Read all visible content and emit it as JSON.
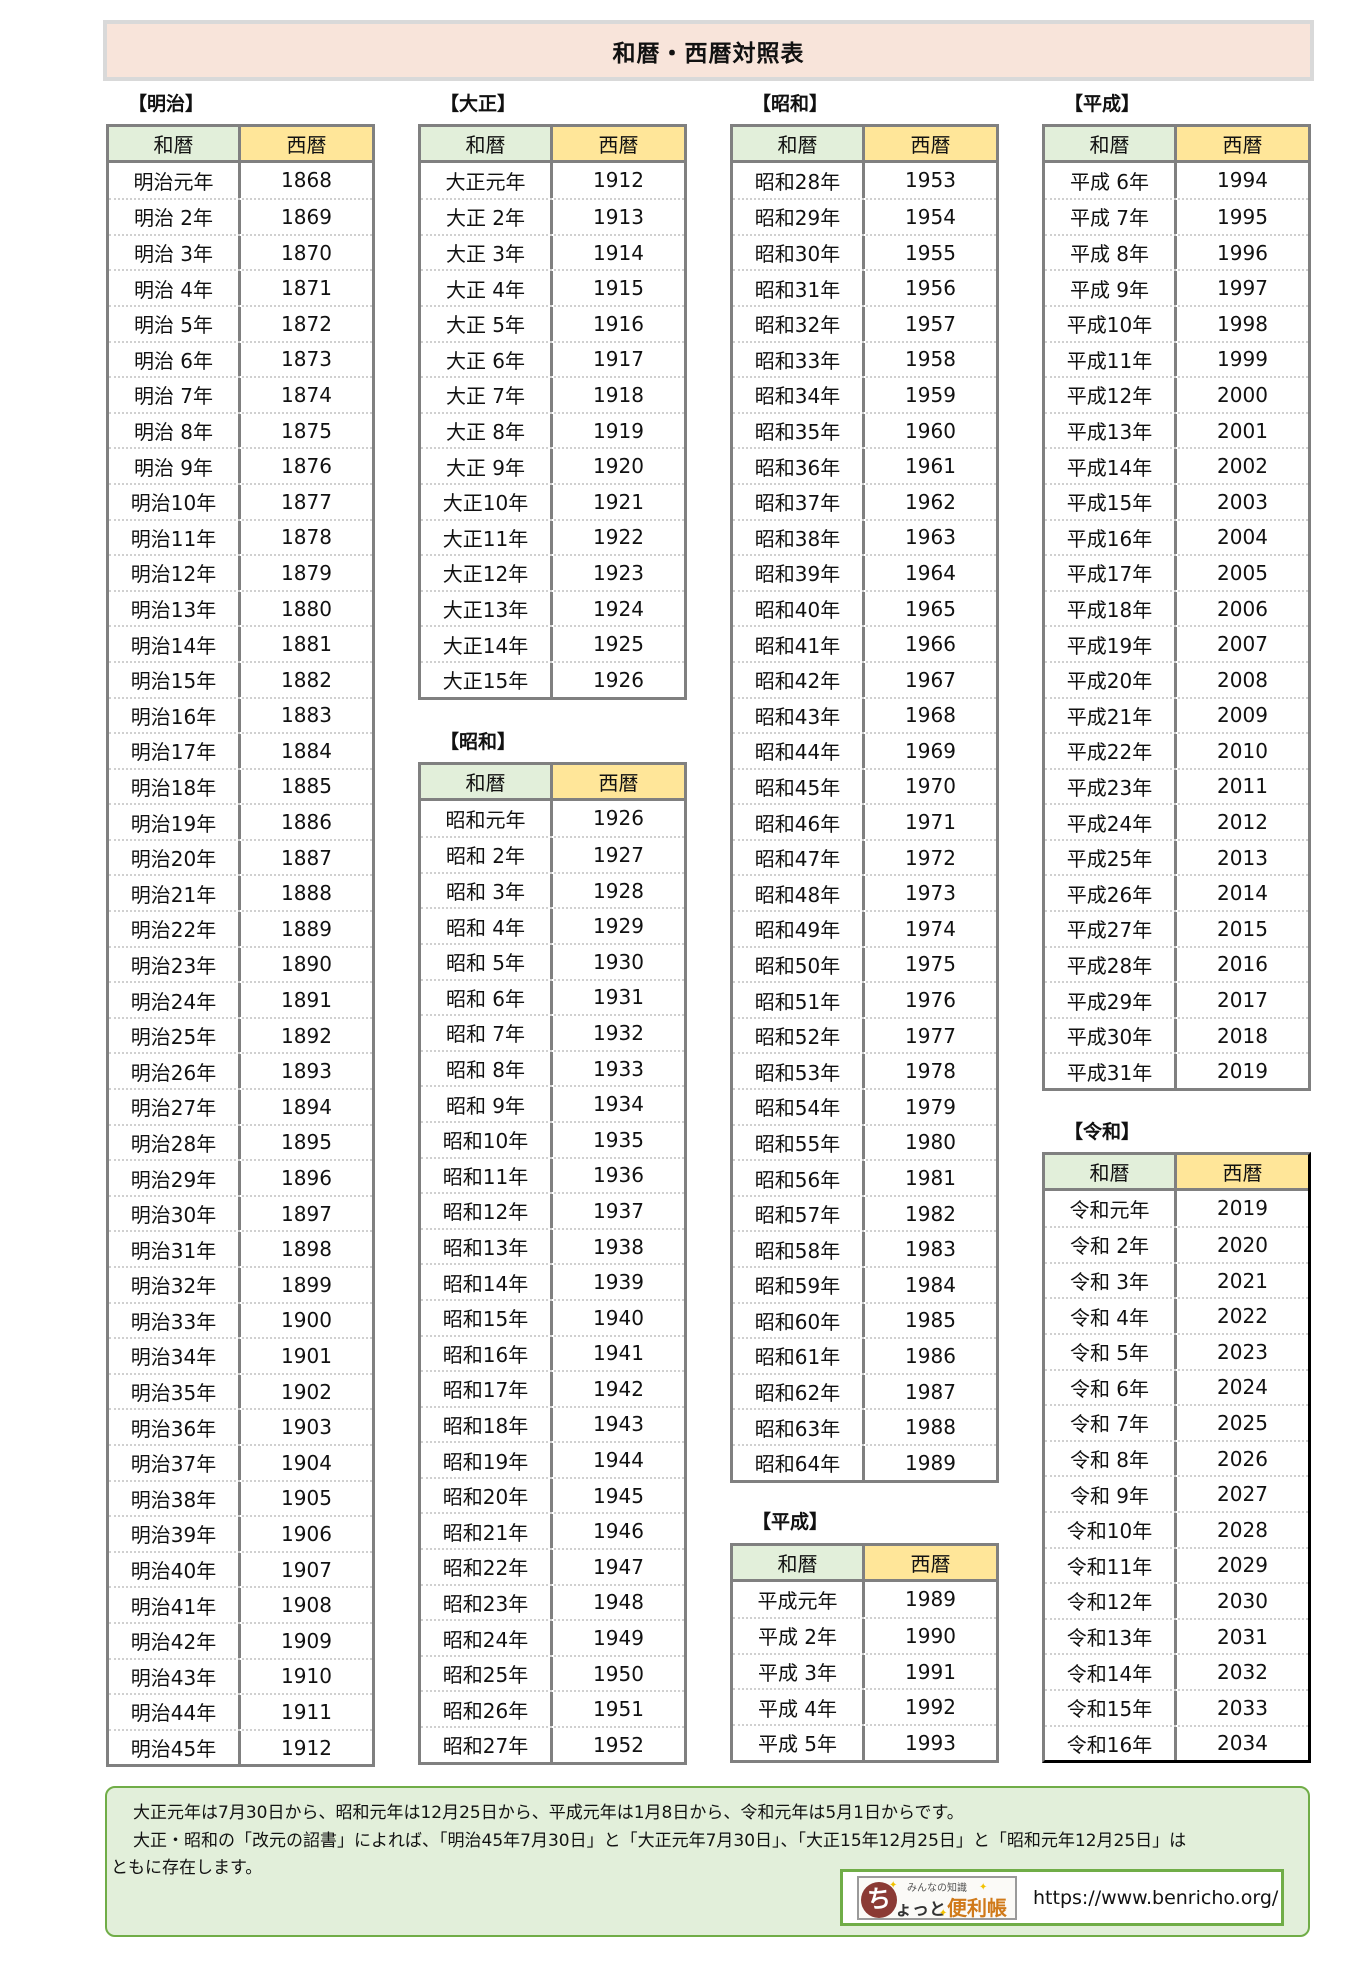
{
  "title": "和暦・西暦対照表",
  "header": {
    "wareki": "和暦",
    "seireki": "西暦"
  },
  "colors": {
    "title_fill": "#f8e4da",
    "wareki_header": "#e2efda",
    "seireki_header": "#ffe699",
    "border": "#808080",
    "footer_fill": "#e2efda",
    "footer_border": "#70ad47"
  },
  "tables": [
    {
      "label": "【明治】",
      "rows": [
        [
          "明治元年",
          "1868"
        ],
        [
          "明治 2年",
          "1869"
        ],
        [
          "明治 3年",
          "1870"
        ],
        [
          "明治 4年",
          "1871"
        ],
        [
          "明治 5年",
          "1872"
        ],
        [
          "明治 6年",
          "1873"
        ],
        [
          "明治 7年",
          "1874"
        ],
        [
          "明治 8年",
          "1875"
        ],
        [
          "明治 9年",
          "1876"
        ],
        [
          "明治10年",
          "1877"
        ],
        [
          "明治11年",
          "1878"
        ],
        [
          "明治12年",
          "1879"
        ],
        [
          "明治13年",
          "1880"
        ],
        [
          "明治14年",
          "1881"
        ],
        [
          "明治15年",
          "1882"
        ],
        [
          "明治16年",
          "1883"
        ],
        [
          "明治17年",
          "1884"
        ],
        [
          "明治18年",
          "1885"
        ],
        [
          "明治19年",
          "1886"
        ],
        [
          "明治20年",
          "1887"
        ],
        [
          "明治21年",
          "1888"
        ],
        [
          "明治22年",
          "1889"
        ],
        [
          "明治23年",
          "1890"
        ],
        [
          "明治24年",
          "1891"
        ],
        [
          "明治25年",
          "1892"
        ],
        [
          "明治26年",
          "1893"
        ],
        [
          "明治27年",
          "1894"
        ],
        [
          "明治28年",
          "1895"
        ],
        [
          "明治29年",
          "1896"
        ],
        [
          "明治30年",
          "1897"
        ],
        [
          "明治31年",
          "1898"
        ],
        [
          "明治32年",
          "1899"
        ],
        [
          "明治33年",
          "1900"
        ],
        [
          "明治34年",
          "1901"
        ],
        [
          "明治35年",
          "1902"
        ],
        [
          "明治36年",
          "1903"
        ],
        [
          "明治37年",
          "1904"
        ],
        [
          "明治38年",
          "1905"
        ],
        [
          "明治39年",
          "1906"
        ],
        [
          "明治40年",
          "1907"
        ],
        [
          "明治41年",
          "1908"
        ],
        [
          "明治42年",
          "1909"
        ],
        [
          "明治43年",
          "1910"
        ],
        [
          "明治44年",
          "1911"
        ],
        [
          "明治45年",
          "1912"
        ]
      ]
    },
    {
      "label": "【大正】",
      "rows": [
        [
          "大正元年",
          "1912"
        ],
        [
          "大正 2年",
          "1913"
        ],
        [
          "大正 3年",
          "1914"
        ],
        [
          "大正 4年",
          "1915"
        ],
        [
          "大正 5年",
          "1916"
        ],
        [
          "大正 6年",
          "1917"
        ],
        [
          "大正 7年",
          "1918"
        ],
        [
          "大正 8年",
          "1919"
        ],
        [
          "大正 9年",
          "1920"
        ],
        [
          "大正10年",
          "1921"
        ],
        [
          "大正11年",
          "1922"
        ],
        [
          "大正12年",
          "1923"
        ],
        [
          "大正13年",
          "1924"
        ],
        [
          "大正14年",
          "1925"
        ],
        [
          "大正15年",
          "1926"
        ]
      ]
    },
    {
      "label": "【昭和】",
      "rows": [
        [
          "昭和元年",
          "1926"
        ],
        [
          "昭和 2年",
          "1927"
        ],
        [
          "昭和 3年",
          "1928"
        ],
        [
          "昭和 4年",
          "1929"
        ],
        [
          "昭和 5年",
          "1930"
        ],
        [
          "昭和 6年",
          "1931"
        ],
        [
          "昭和 7年",
          "1932"
        ],
        [
          "昭和 8年",
          "1933"
        ],
        [
          "昭和 9年",
          "1934"
        ],
        [
          "昭和10年",
          "1935"
        ],
        [
          "昭和11年",
          "1936"
        ],
        [
          "昭和12年",
          "1937"
        ],
        [
          "昭和13年",
          "1938"
        ],
        [
          "昭和14年",
          "1939"
        ],
        [
          "昭和15年",
          "1940"
        ],
        [
          "昭和16年",
          "1941"
        ],
        [
          "昭和17年",
          "1942"
        ],
        [
          "昭和18年",
          "1943"
        ],
        [
          "昭和19年",
          "1944"
        ],
        [
          "昭和20年",
          "1945"
        ],
        [
          "昭和21年",
          "1946"
        ],
        [
          "昭和22年",
          "1947"
        ],
        [
          "昭和23年",
          "1948"
        ],
        [
          "昭和24年",
          "1949"
        ],
        [
          "昭和25年",
          "1950"
        ],
        [
          "昭和26年",
          "1951"
        ],
        [
          "昭和27年",
          "1952"
        ]
      ]
    },
    {
      "label": "【昭和】",
      "rows": [
        [
          "昭和28年",
          "1953"
        ],
        [
          "昭和29年",
          "1954"
        ],
        [
          "昭和30年",
          "1955"
        ],
        [
          "昭和31年",
          "1956"
        ],
        [
          "昭和32年",
          "1957"
        ],
        [
          "昭和33年",
          "1958"
        ],
        [
          "昭和34年",
          "1959"
        ],
        [
          "昭和35年",
          "1960"
        ],
        [
          "昭和36年",
          "1961"
        ],
        [
          "昭和37年",
          "1962"
        ],
        [
          "昭和38年",
          "1963"
        ],
        [
          "昭和39年",
          "1964"
        ],
        [
          "昭和40年",
          "1965"
        ],
        [
          "昭和41年",
          "1966"
        ],
        [
          "昭和42年",
          "1967"
        ],
        [
          "昭和43年",
          "1968"
        ],
        [
          "昭和44年",
          "1969"
        ],
        [
          "昭和45年",
          "1970"
        ],
        [
          "昭和46年",
          "1971"
        ],
        [
          "昭和47年",
          "1972"
        ],
        [
          "昭和48年",
          "1973"
        ],
        [
          "昭和49年",
          "1974"
        ],
        [
          "昭和50年",
          "1975"
        ],
        [
          "昭和51年",
          "1976"
        ],
        [
          "昭和52年",
          "1977"
        ],
        [
          "昭和53年",
          "1978"
        ],
        [
          "昭和54年",
          "1979"
        ],
        [
          "昭和55年",
          "1980"
        ],
        [
          "昭和56年",
          "1981"
        ],
        [
          "昭和57年",
          "1982"
        ],
        [
          "昭和58年",
          "1983"
        ],
        [
          "昭和59年",
          "1984"
        ],
        [
          "昭和60年",
          "1985"
        ],
        [
          "昭和61年",
          "1986"
        ],
        [
          "昭和62年",
          "1987"
        ],
        [
          "昭和63年",
          "1988"
        ],
        [
          "昭和64年",
          "1989"
        ]
      ]
    },
    {
      "label": "【平成】",
      "rows": [
        [
          "平成元年",
          "1989"
        ],
        [
          "平成 2年",
          "1990"
        ],
        [
          "平成 3年",
          "1991"
        ],
        [
          "平成 4年",
          "1992"
        ],
        [
          "平成 5年",
          "1993"
        ]
      ]
    },
    {
      "label": "【平成】",
      "rows": [
        [
          "平成 6年",
          "1994"
        ],
        [
          "平成 7年",
          "1995"
        ],
        [
          "平成 8年",
          "1996"
        ],
        [
          "平成 9年",
          "1997"
        ],
        [
          "平成10年",
          "1998"
        ],
        [
          "平成11年",
          "1999"
        ],
        [
          "平成12年",
          "2000"
        ],
        [
          "平成13年",
          "2001"
        ],
        [
          "平成14年",
          "2002"
        ],
        [
          "平成15年",
          "2003"
        ],
        [
          "平成16年",
          "2004"
        ],
        [
          "平成17年",
          "2005"
        ],
        [
          "平成18年",
          "2006"
        ],
        [
          "平成19年",
          "2007"
        ],
        [
          "平成20年",
          "2008"
        ],
        [
          "平成21年",
          "2009"
        ],
        [
          "平成22年",
          "2010"
        ],
        [
          "平成23年",
          "2011"
        ],
        [
          "平成24年",
          "2012"
        ],
        [
          "平成25年",
          "2013"
        ],
        [
          "平成26年",
          "2014"
        ],
        [
          "平成27年",
          "2015"
        ],
        [
          "平成28年",
          "2016"
        ],
        [
          "平成29年",
          "2017"
        ],
        [
          "平成30年",
          "2018"
        ],
        [
          "平成31年",
          "2019"
        ]
      ]
    },
    {
      "label": "【令和】",
      "rows": [
        [
          "令和元年",
          "2019"
        ],
        [
          "令和 2年",
          "2020"
        ],
        [
          "令和 3年",
          "2021"
        ],
        [
          "令和 4年",
          "2022"
        ],
        [
          "令和 5年",
          "2023"
        ],
        [
          "令和 6年",
          "2024"
        ],
        [
          "令和 7年",
          "2025"
        ],
        [
          "令和 8年",
          "2026"
        ],
        [
          "令和 9年",
          "2027"
        ],
        [
          "令和10年",
          "2028"
        ],
        [
          "令和11年",
          "2029"
        ],
        [
          "令和12年",
          "2030"
        ],
        [
          "令和13年",
          "2031"
        ],
        [
          "令和14年",
          "2032"
        ],
        [
          "令和15年",
          "2033"
        ],
        [
          "令和16年",
          "2034"
        ]
      ]
    }
  ],
  "footer": {
    "line1": "大正元年は7月30日から、昭和元年は12月25日から、平成元年は1月8日から、令和元年は5月1日からです。",
    "line2": "大正・昭和の「改元の詔書」によれば、「明治45年7月30日」と「大正元年7月30日」、「大正15年12月25日」と「昭和元年12月25日」は",
    "line3": "ともに存在します。",
    "logo": {
      "small": "みんなの知識",
      "char": "ち",
      "mid": "ょっと",
      "big": "便利帳",
      "icon": "benricho-logo-icon"
    },
    "url": "https://www.benricho.org/"
  }
}
